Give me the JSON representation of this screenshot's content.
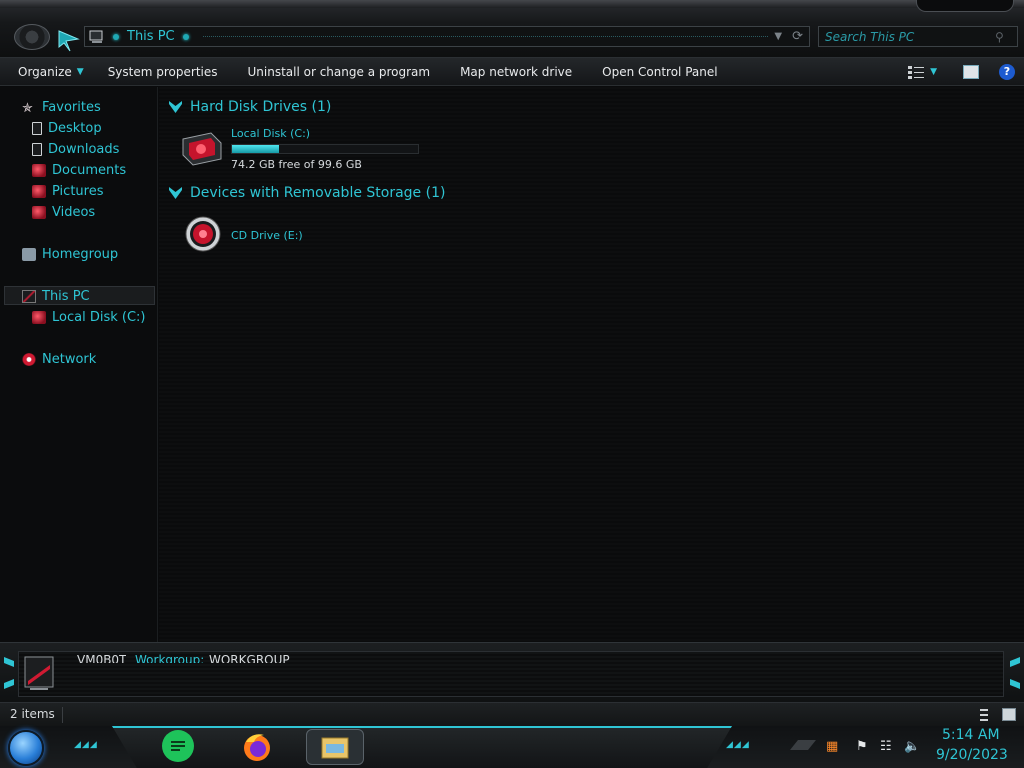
{
  "address": {
    "location": "This PC"
  },
  "search": {
    "placeholder": "Search This PC"
  },
  "toolbar": {
    "organize": "Organize",
    "system_properties": "System properties",
    "uninstall": "Uninstall or change a program",
    "map_drive": "Map network drive",
    "control_panel": "Open Control Panel",
    "help_icon": "?"
  },
  "nav": {
    "favorites": "Favorites",
    "desktop": "Desktop",
    "downloads": "Downloads",
    "documents": "Documents",
    "pictures": "Pictures",
    "videos": "Videos",
    "homegroup": "Homegroup",
    "this_pc": "This PC",
    "local_disk": "Local Disk (C:)",
    "network": "Network"
  },
  "content": {
    "hdd_group": "Hard Disk Drives (1)",
    "removable_group": "Devices with Removable Storage (1)",
    "local_disk": {
      "name": "Local Disk (C:)",
      "free_text": "74.2 GB free of 99.6 GB",
      "used_fraction": 0.255
    },
    "cd_drive": {
      "name": "CD Drive (E:)"
    }
  },
  "details": {
    "name": "VM0B0T",
    "workgroup_label": "Workgroup:",
    "workgroup_value": "WORKGROUP"
  },
  "status": {
    "item_count": "2 items"
  },
  "taskbar": {
    "clock_time": "5:14 AM",
    "clock_date": "9/20/2023"
  },
  "colors": {
    "accent": "#2fc5d4",
    "text": "#d6dadd",
    "background": "#0a0b0c",
    "drive_red": "#d01a32"
  }
}
